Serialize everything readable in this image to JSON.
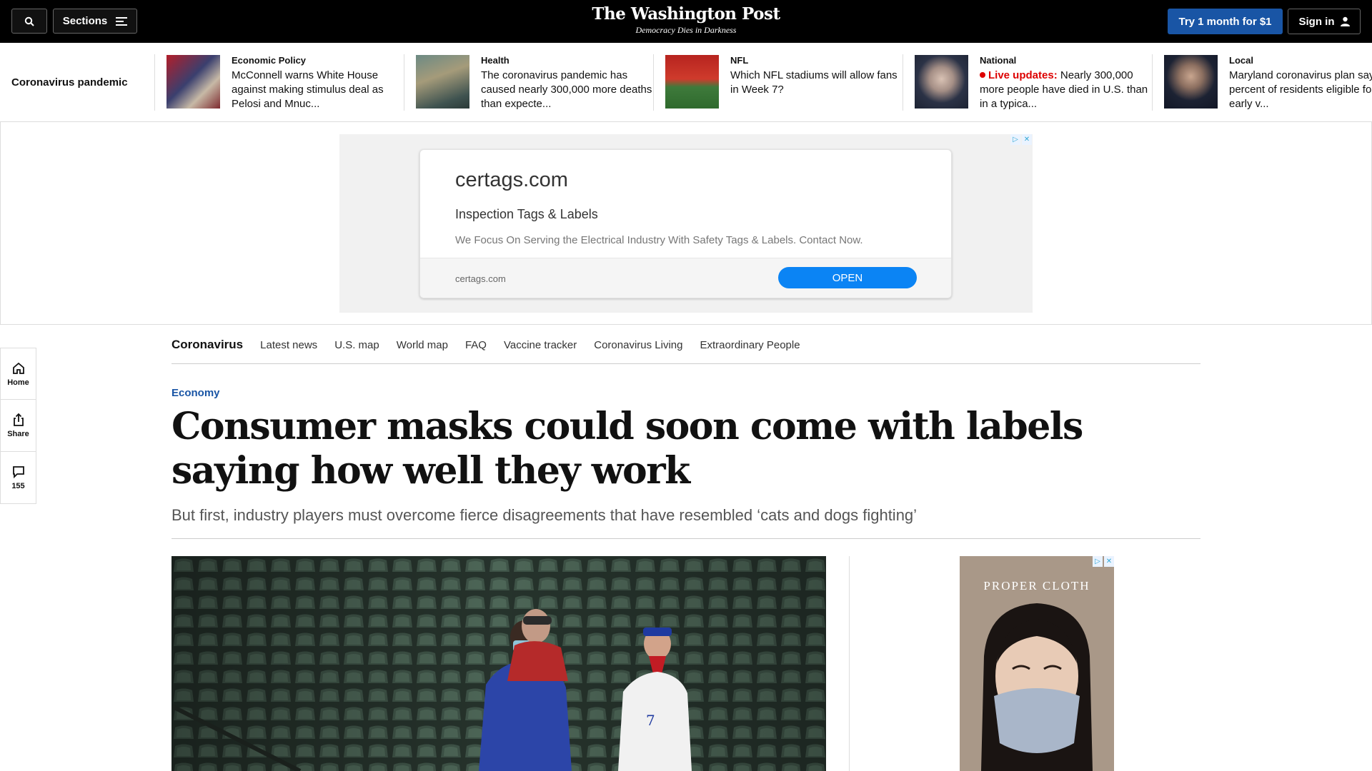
{
  "header": {
    "sections_label": "Sections",
    "logo_text": "The Washington Post",
    "tagline": "Democracy Dies in Darkness",
    "try_label": "Try 1 month for $1",
    "signin_label": "Sign in"
  },
  "strip": {
    "label": "Coronavirus pandemic",
    "items": [
      {
        "kicker": "Economic Policy",
        "headline": "McConnell warns White House against making stimulus deal as Pelosi and Mnuc..."
      },
      {
        "kicker": "Health",
        "headline": "The coronavirus pandemic has caused nearly 300,000 more deaths than expecte..."
      },
      {
        "kicker": "NFL",
        "headline": "Which NFL stadiums will allow fans in Week 7?"
      },
      {
        "kicker": "National",
        "live": "Live updates:",
        "headline": "Nearly 300,000 more people have died in U.S. than in a typica..."
      },
      {
        "kicker": "Local",
        "headline": "Maryland coronavirus plan says 14 percent of residents eligible for early v..."
      }
    ]
  },
  "ad": {
    "domain": "certags.com",
    "title": "Inspection Tags & Labels",
    "description": "We Focus On Serving the Electrical Industry With Safety Tags & Labels. Contact Now.",
    "footer_url": "certags.com",
    "cta": "OPEN"
  },
  "rail": {
    "home": "Home",
    "share": "Share",
    "comments": "155"
  },
  "subnav": {
    "first": "Coronavirus",
    "links": [
      "Latest news",
      "U.S. map",
      "World map",
      "FAQ",
      "Vaccine tracker",
      "Coronavirus Living",
      "Extraordinary People"
    ]
  },
  "article": {
    "kicker": "Economy",
    "headline": "Consumer masks could soon come with labels saying how well they work",
    "dek": "But first, industry players must overcome fierce disagreements that have resembled ‘cats and dogs fighting’"
  },
  "side_ad": {
    "brand": "PROPER CLOTH"
  }
}
